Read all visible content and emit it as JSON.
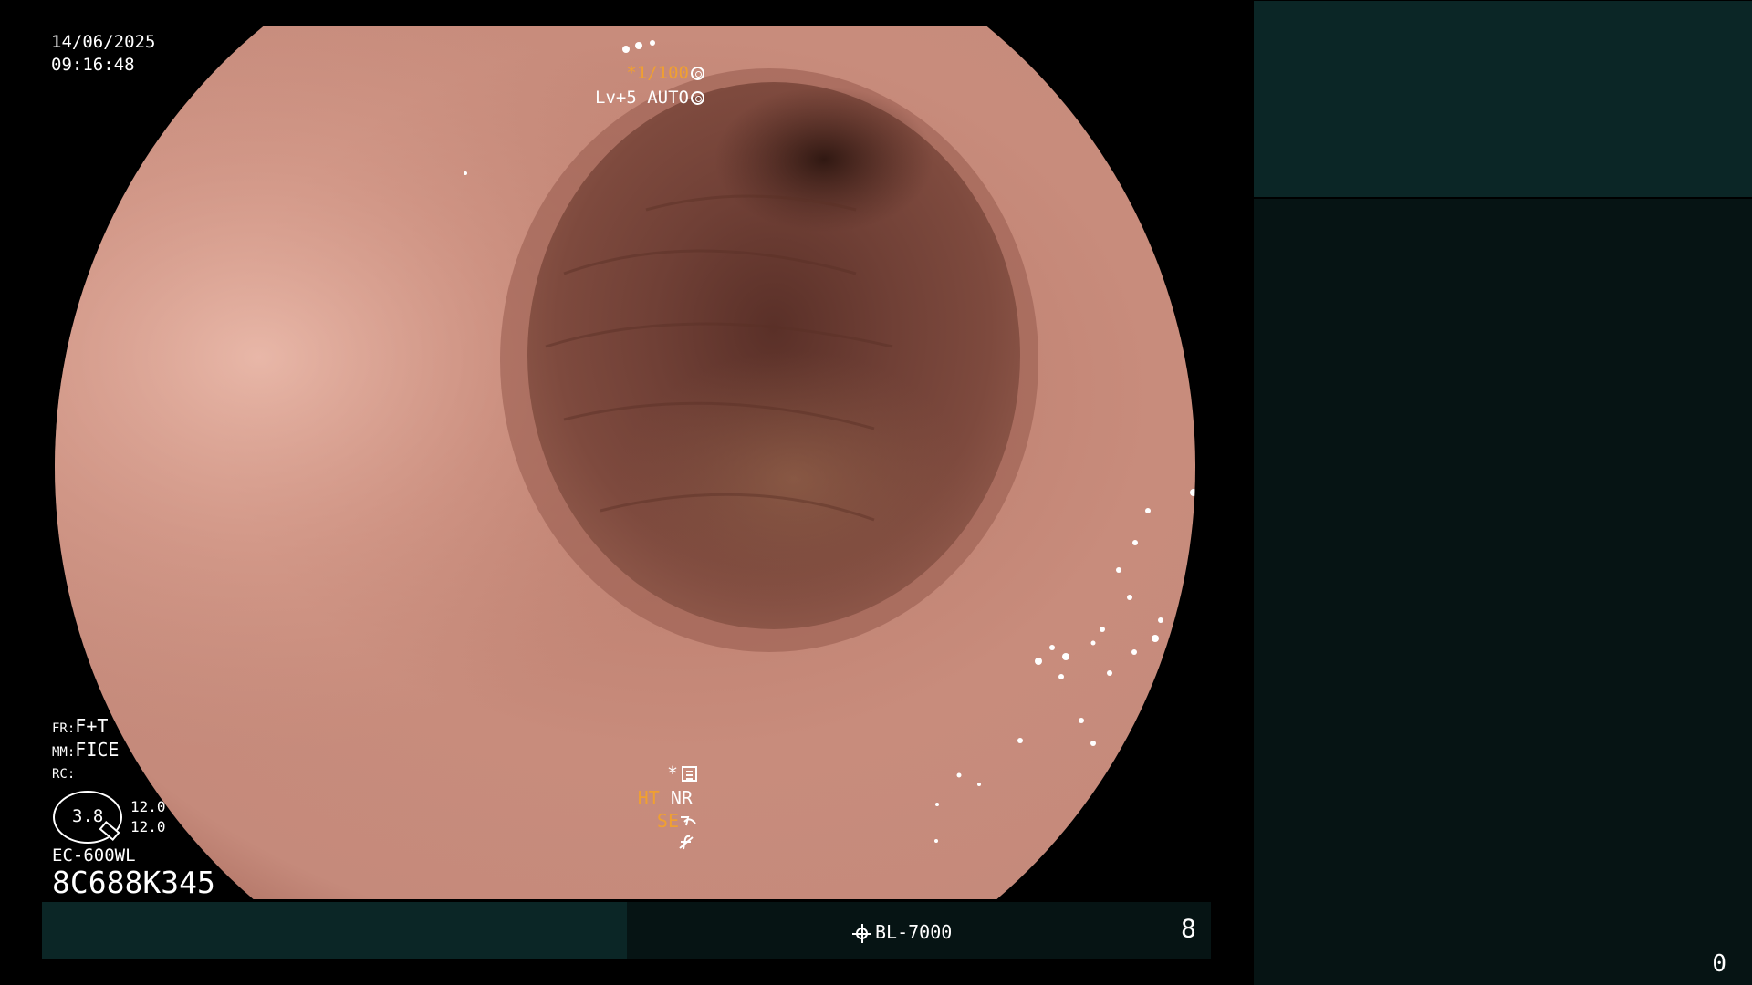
{
  "overlay": {
    "date": "14/06/2025",
    "time": "09:16:48",
    "shutter_prefix": "*",
    "shutter_value": "1/100",
    "iris_label": "Lv+5",
    "iris_mode": "AUTO",
    "fr_label": "FR:",
    "fr_value": "F+T",
    "mm_label": "MM:",
    "mm_value": "FICE",
    "rc_label": "RC:",
    "dial_value": "3.8",
    "dial_top": "12.0",
    "dial_bottom": "12.0",
    "scope_model": "EC-600WL",
    "serial_number": "8C688K345",
    "asterisk": "*",
    "ht_label": "HT",
    "nr_label": "NR",
    "se_label": "SE",
    "se_icon": "curve-icon",
    "f_icon": "slashed-f-icon",
    "menu_icon": "settings-list-icon",
    "shutter_icon": "aperture-icon",
    "iris_icon": "iris-icon"
  },
  "bottom_bar": {
    "light_source": "BL-7000",
    "light_icon": "sun-icon",
    "number": "8"
  },
  "right_panel": {
    "corner_number": "0"
  },
  "colors": {
    "background": "#000000",
    "text": "#ffffff",
    "accent_orange": "#f0a030",
    "panel_teal": "#0b2626",
    "panel_dark": "#061414"
  }
}
